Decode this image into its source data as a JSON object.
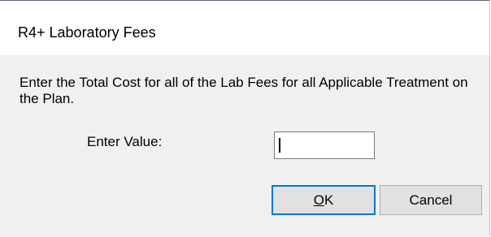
{
  "dialog": {
    "title": "R4+ Laboratory Fees",
    "message": "Enter the Total Cost for all of the Lab Fees for all Applicable Treatment on the Plan.",
    "value_label": "Enter Value:",
    "value_input": {
      "value": "",
      "placeholder": ""
    },
    "buttons": {
      "ok_mnemonic": "O",
      "ok_rest": "K",
      "cancel": "Cancel"
    }
  },
  "colors": {
    "dialog_background": "#f0f0f0",
    "titlebar_background": "#ffffff",
    "default_button_border": "#0078d7",
    "button_background": "#e1e1e1"
  }
}
